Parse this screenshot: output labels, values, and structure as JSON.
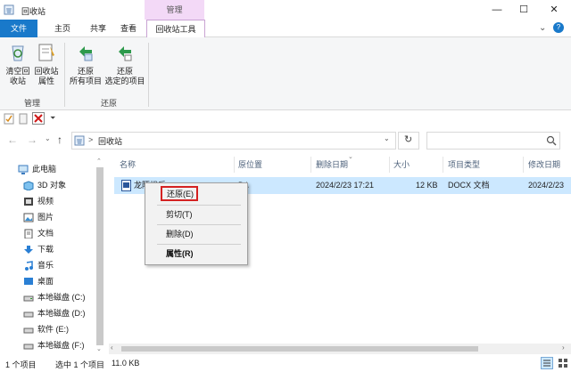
{
  "window": {
    "title": "回收站",
    "context_tab_header": "管理",
    "minimize": "—",
    "maximize": "☐",
    "close": "✕",
    "help": "?"
  },
  "tabs": [
    "文件",
    "主页",
    "共享",
    "查看",
    "回收站工具"
  ],
  "ribbon": {
    "empty_bin": [
      "清空回",
      "收站"
    ],
    "bin_props": [
      "回收站",
      "属性"
    ],
    "restore_all": [
      "还原",
      "所有项目"
    ],
    "restore_selected": [
      "还原",
      "选定的项目"
    ],
    "group_manage": "管理",
    "group_restore": "还原"
  },
  "address": {
    "path": "回收站",
    "separator": ">"
  },
  "nav": [
    "此电脑",
    "3D 对象",
    "视频",
    "图片",
    "文档",
    "下载",
    "音乐",
    "桌面",
    "本地磁盘 (C:)",
    "本地磁盘 (D:)",
    "软件 (E:)",
    "本地磁盘 (F:)"
  ],
  "columns": [
    "名称",
    "原位置",
    "删除日期",
    "大小",
    "项目类型",
    "修改日期"
  ],
  "file": {
    "name": "龙陌拔后",
    "location": "D:\\",
    "deleted": "2024/2/23 17:21",
    "size": "12 KB",
    "type": "DOCX 文档",
    "modified": "2024/2/23"
  },
  "context_menu": [
    "还原(E)",
    "剪切(T)",
    "删除(D)",
    "属性(R)"
  ],
  "status": {
    "count": "1 个项目",
    "selected": "选中 1 个项目",
    "size": "11.0 KB"
  },
  "colors": {
    "accent": "#1979ca",
    "context_tab": "#f3d9f7",
    "selection": "#cce8ff",
    "highlight_border": "#d42222"
  }
}
